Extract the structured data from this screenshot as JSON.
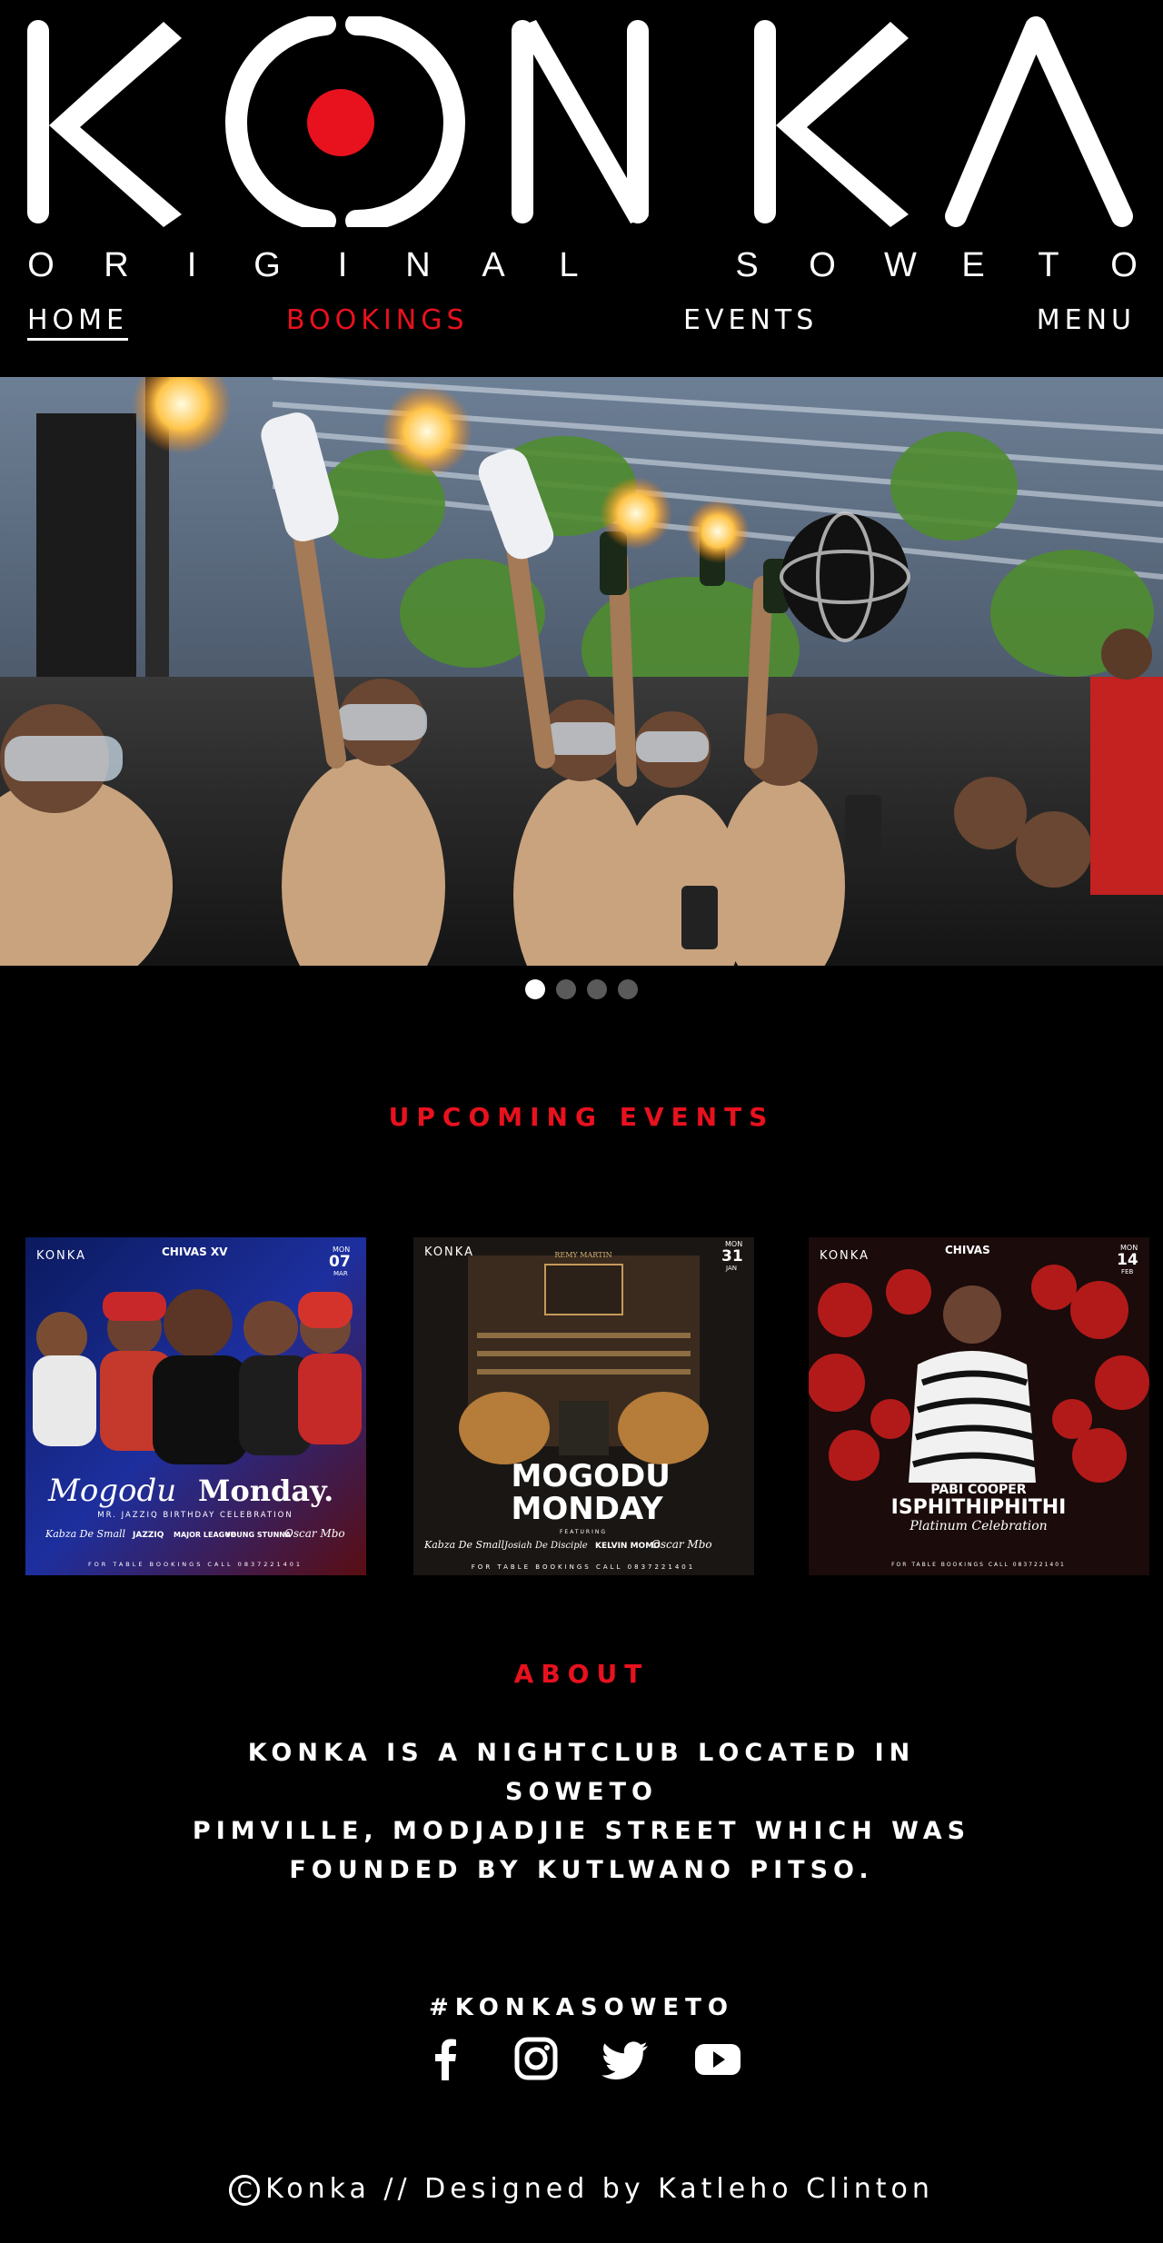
{
  "brand": {
    "logo_letters": [
      "K",
      "O",
      "N",
      "K",
      "A"
    ],
    "tagline_left": [
      "O",
      "R",
      "I",
      "G",
      "I",
      "N",
      "A",
      "L"
    ],
    "tagline_right": [
      "S",
      "O",
      "W",
      "E",
      "T",
      "O"
    ],
    "accent_color": "#e8111e"
  },
  "nav": {
    "home": "HOME",
    "bookings": "BOOKINGS",
    "events": "EVENTS",
    "menu": "MENU"
  },
  "hero": {
    "slides_count": 4,
    "active_slide": 1
  },
  "upcoming": {
    "title": "UPCOMING EVENTS",
    "cards": [
      {
        "brand": "KONKA",
        "sponsor": "CHIVAS XV",
        "day": "MON",
        "date": "07",
        "month": "MAR",
        "headline_script": "Mogodu",
        "headline": "Monday.",
        "subtitle": "MR. JAZZIQ BIRTHDAY CELEBRATION",
        "lineup": [
          "Kabza De Small",
          "JAZZIQ",
          "MAJOR LEAGUE",
          "YOUNG STUNNA",
          "Oscar Mbo"
        ],
        "booking": "FOR TABLE BOOKINGS CALL 0837221401"
      },
      {
        "brand": "KONKA",
        "sponsor": "REMY MARTIN",
        "day": "MON",
        "date": "31",
        "month": "JAN",
        "headline": "MOGODU MONDAY",
        "subtitle": "FEATURING",
        "lineup": [
          "Kabza De Small",
          "Josiah De Disciple",
          "KELVIN MOMO",
          "Oscar Mbo"
        ],
        "booking": "FOR TABLE BOOKINGS CALL 0837221401"
      },
      {
        "brand": "KONKA",
        "sponsor": "CHIVAS",
        "day": "MON",
        "date": "14",
        "month": "FEB",
        "headline_small": "PABI COOPER",
        "headline": "ISPHITHIPHITHI",
        "subtitle": "Platinum Celebration",
        "booking": "FOR TABLE BOOKINGS CALL 0837221401"
      }
    ]
  },
  "about": {
    "title": "ABOUT",
    "lines": [
      "KONKA IS A NIGHTCLUB LOCATED IN SOWETO",
      "PIMVILLE, MODJADJIE STREET WHICH WAS",
      "FOUNDED BY KUTLWANO PITSO."
    ]
  },
  "social": {
    "hashtag": "#KONKASOWETO",
    "icons": [
      "facebook-icon",
      "instagram-icon",
      "twitter-icon",
      "youtube-icon"
    ]
  },
  "footer": {
    "copyright_symbol": "C",
    "text": "Konka // Designed by Katleho Clinton"
  }
}
